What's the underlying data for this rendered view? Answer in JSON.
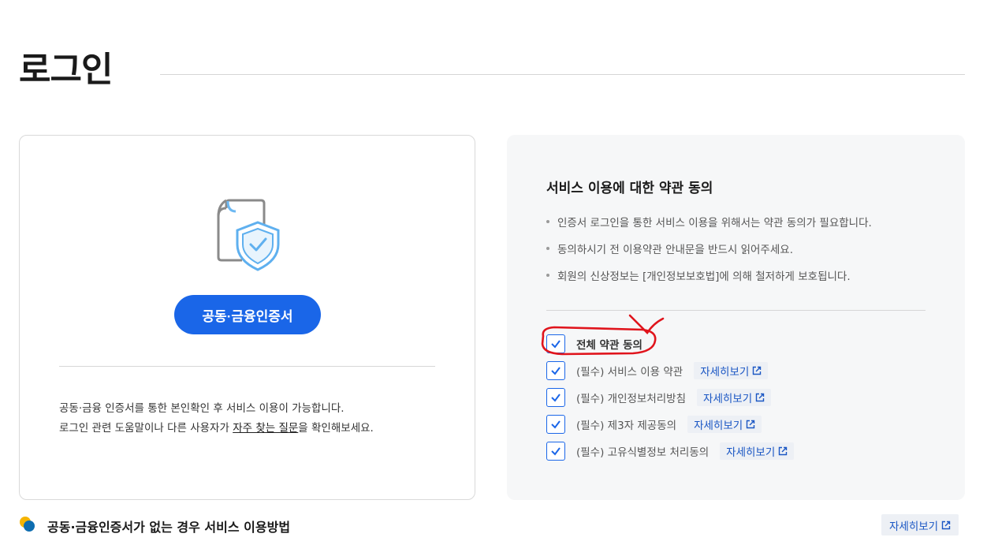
{
  "page": {
    "title": "로그인"
  },
  "left_card": {
    "cert_button_label": "공동·금융인증서",
    "desc_line1": "공동·금융 인증서를 통한 본인확인 후 서비스 이용이 가능합니다.",
    "desc_line2_before": "로그인 관련 도움말이나 다른 사용자가 ",
    "desc_line2_link": "자주 찾는 질문",
    "desc_line2_after": "을 확인해보세요."
  },
  "terms": {
    "title": "서비스 이용에 대한 약관 동의",
    "notices": [
      "인증서 로그인을 통한 서비스 이용을 위해서는 약관 동의가 필요합니다.",
      "동의하시기 전 이용약관 안내문을 반드시 읽어주세요.",
      "회원의 신상정보는 [개인정보보호법]에 의해 철저하게 보호됩니다."
    ],
    "agree_all_label": "전체 약관 동의",
    "items": [
      {
        "label": "(필수) 서비스 이용 약관",
        "detail": "자세히보기",
        "checked": true
      },
      {
        "label": "(필수) 개인정보처리방침",
        "detail": "자세히보기",
        "checked": true
      },
      {
        "label": "(필수) 제3자 제공동의",
        "detail": "자세히보기",
        "checked": true
      },
      {
        "label": "(필수) 고유식별정보 처리동의",
        "detail": "자세히보기",
        "checked": true
      }
    ]
  },
  "bottom": {
    "title": "공동·금융인증서가 없는 경우 서비스 이용방법",
    "detail": "자세히보기"
  },
  "colors": {
    "accent": "#1a66e8",
    "link": "#1a56c4",
    "annotation": "#e0141c"
  }
}
